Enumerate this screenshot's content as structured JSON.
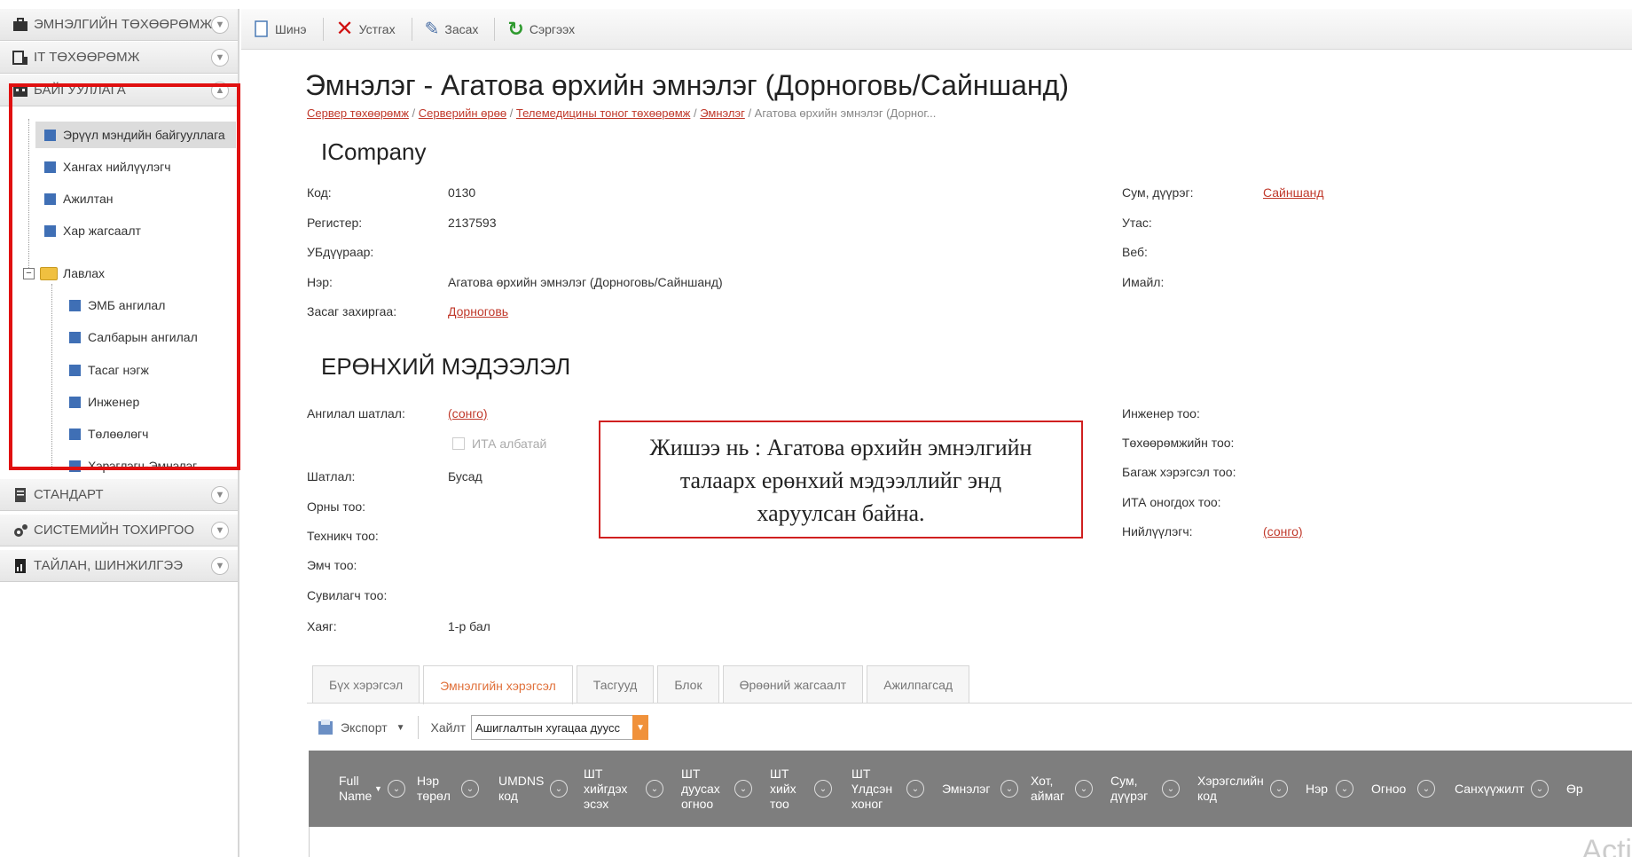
{
  "sidebar": {
    "sections": [
      {
        "label": "ЭМНЭЛГИЙН ТӨХӨӨРӨМЖ"
      },
      {
        "label": "IT ТӨХӨӨРӨМЖ"
      },
      {
        "label": "БАЙГУУЛЛАГА"
      },
      {
        "label": "СТАНДАРТ"
      },
      {
        "label": "СИСТЕМИЙН ТОХИРГОО"
      },
      {
        "label": "ТАЙЛАН, ШИНЖИЛГЭЭ"
      }
    ],
    "tree": [
      {
        "label": "Эрүүл мэндийн байгууллага"
      },
      {
        "label": "Хангах нийлүүлэгч"
      },
      {
        "label": "Ажилтан"
      },
      {
        "label": "Хар жагсаалт"
      },
      {
        "label": "Лавлах"
      },
      {
        "label": "ЭМБ ангилал"
      },
      {
        "label": "Салбарын ангилал"
      },
      {
        "label": "Тасаг нэгж"
      },
      {
        "label": "Инженер"
      },
      {
        "label": "Төлөөлөгч"
      },
      {
        "label": "Хэрэглэгч-Эмнэлэг"
      }
    ]
  },
  "toolbar": {
    "new_label": "Шинэ",
    "delete_label": "Устгах",
    "edit_label": "Засах",
    "refresh_label": "Сэргээх"
  },
  "page": {
    "title": "Эмнэлэг - Агатова өрхийн эмнэлэг (Дорноговь/Сайншанд)",
    "breadcrumb": [
      "Сервер төхөөрөмж",
      "Серверийн өрөө",
      "Телемедицины тоног төхөөрөмж",
      "Эмнэлэг"
    ],
    "breadcrumb_current": "Агатова өрхийн эмнэлэг (Дорног...",
    "section1": "ICompany",
    "section2": "ЕРӨНХИЙ МЭДЭЭЛЭЛ"
  },
  "company": {
    "code_label": "Код:",
    "code": "0130",
    "register_label": "Регистер:",
    "register": "2137593",
    "ub_label": "УБдүүраар:",
    "name_label": "Нэр:",
    "name": "Агатова өрхийн эмнэлэг (Дорноговь/Сайншанд)",
    "gov_label": "Засаг захиргаа:",
    "gov": "Дорноговь",
    "sum_label": "Сум, дүүрэг:",
    "sum": "Сайншанд",
    "phone_label": "Утас:",
    "web_label": "Веб:",
    "email_label": "Имайл:"
  },
  "general": {
    "class_label": "Ангилал шатлал:",
    "class_link": "(сонго)",
    "ita_checkbox": "ИТА албатай",
    "level_label": "Шатлал:",
    "level": "Бусад",
    "beds_label": "Орны тоо:",
    "tech_label": "Техникч тоо:",
    "doctor_label": "Эмч тоо:",
    "nurse_label": "Сувилагч тоо:",
    "address_label": "Хаяг:",
    "address": "1-р бал",
    "engineer_count_label": "Инженер тоо:",
    "device_count_label": "Төхөөрөмжийн тоо:",
    "tool_count_label": "Багаж хэрэгсэл тоо:",
    "ita_count_label": "ИТА оногдох тоо:",
    "supplier_label": "Нийлүүлэгч:",
    "supplier_link": "(сонго)"
  },
  "callout": {
    "line1": "Жишээ нь : Агатова өрхийн эмнэлгийн",
    "line2": "талаарх ерөнхий мэдээллийг энд",
    "line3": "харуулсан байна."
  },
  "tabs": [
    "Бүх хэрэгсэл",
    "Эмнэлгийн хэрэгсэл",
    "Тасгууд",
    "Блок",
    "Өрөөний жагсаалт",
    "Ажилпагсад"
  ],
  "grid": {
    "export_label": "Экспорт",
    "search_label": "Хайлт",
    "search_value": "Ашиглалтын хугацаа дуусс",
    "columns": [
      "Full Name",
      "Нэр төрөл",
      "UMDNS код",
      "ШТ хийгдэх эсэх",
      "ШТ дуусах огноо",
      "ШТ хийх тоо",
      "ШТ Үлдсэн хоног",
      "Эмнэлэг",
      "Хот, аймаг",
      "Сум, дүүрэг",
      "Хэрэгслийн код",
      "Нэр",
      "Огноо",
      "Санхүүжилт",
      "Өр"
    ]
  },
  "watermark": "Acti"
}
